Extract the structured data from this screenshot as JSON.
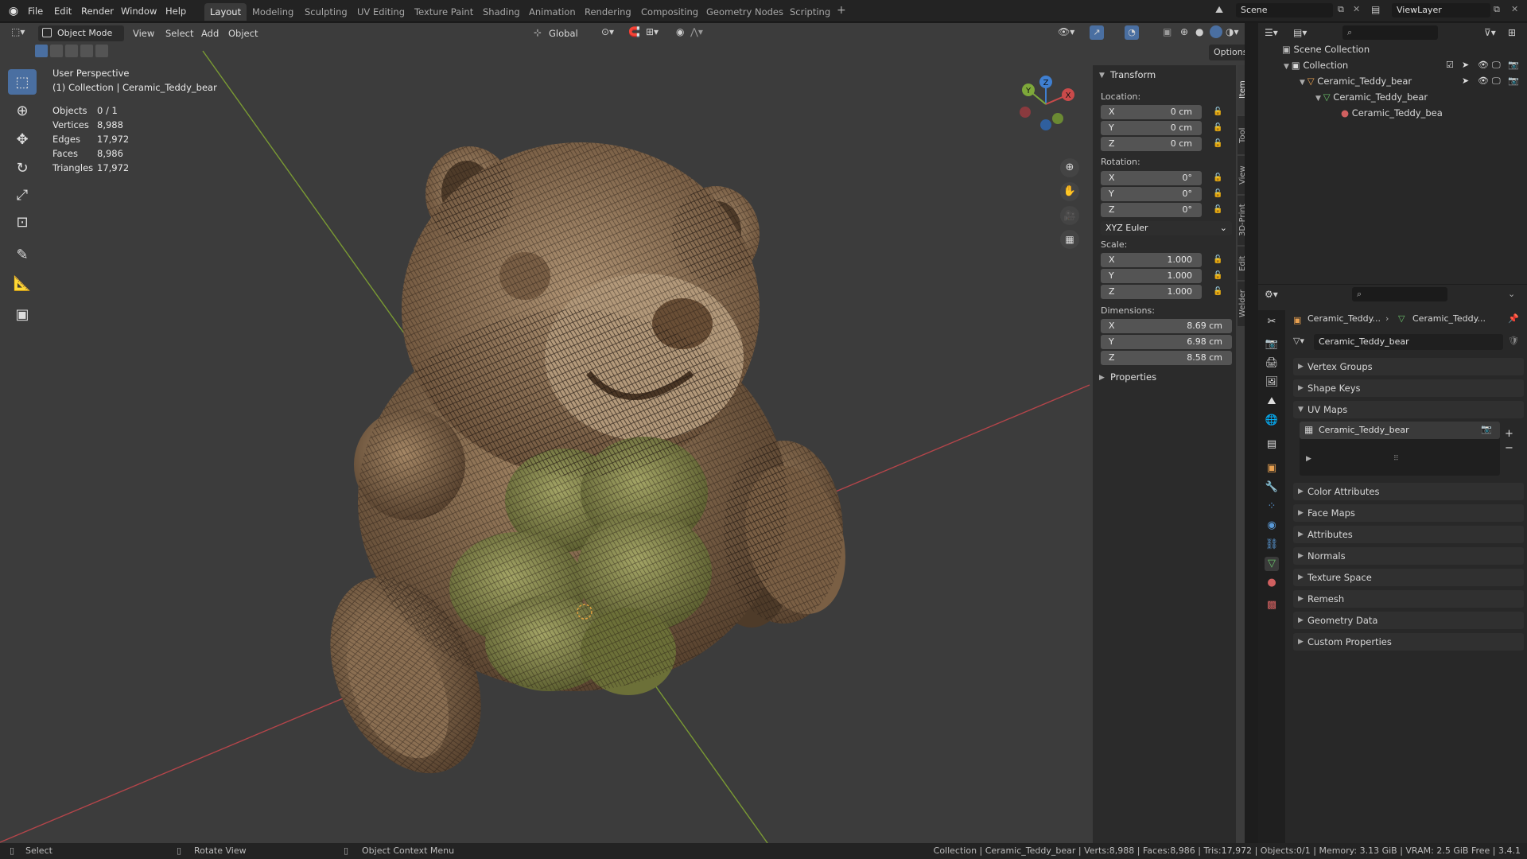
{
  "menu": [
    "File",
    "Edit",
    "Render",
    "Window",
    "Help"
  ],
  "workspaces": [
    "Layout",
    "Modeling",
    "Sculpting",
    "UV Editing",
    "Texture Paint",
    "Shading",
    "Animation",
    "Rendering",
    "Compositing",
    "Geometry Nodes",
    "Scripting"
  ],
  "active_workspace": "Layout",
  "scene": "Scene",
  "view_layer": "ViewLayer",
  "viewport": {
    "mode": "Object Mode",
    "menus": [
      "View",
      "Select",
      "Add",
      "Object"
    ],
    "orientation": "Global",
    "options": "Options",
    "overlay_title": "User Perspective",
    "overlay_subtitle": "(1) Collection | Ceramic_Teddy_bear",
    "stats": [
      {
        "label": "Objects",
        "value": "0 / 1"
      },
      {
        "label": "Vertices",
        "value": "8,988"
      },
      {
        "label": "Edges",
        "value": "17,972"
      },
      {
        "label": "Faces",
        "value": "8,986"
      },
      {
        "label": "Triangles",
        "value": "17,972"
      }
    ],
    "gizmo_axes": {
      "x": "X",
      "y": "Y",
      "z": "Z"
    }
  },
  "npanel": {
    "transform": "Transform",
    "location_label": "Location:",
    "location": [
      {
        "axis": "X",
        "value": "0 cm"
      },
      {
        "axis": "Y",
        "value": "0 cm"
      },
      {
        "axis": "Z",
        "value": "0 cm"
      }
    ],
    "rotation_label": "Rotation:",
    "rotation": [
      {
        "axis": "X",
        "value": "0°"
      },
      {
        "axis": "Y",
        "value": "0°"
      },
      {
        "axis": "Z",
        "value": "0°"
      }
    ],
    "rotation_mode": "XYZ Euler",
    "scale_label": "Scale:",
    "scale": [
      {
        "axis": "X",
        "value": "1.000"
      },
      {
        "axis": "Y",
        "value": "1.000"
      },
      {
        "axis": "Z",
        "value": "1.000"
      }
    ],
    "dimensions_label": "Dimensions:",
    "dimensions": [
      {
        "axis": "X",
        "value": "8.69 cm"
      },
      {
        "axis": "Y",
        "value": "6.98 cm"
      },
      {
        "axis": "Z",
        "value": "8.58 cm"
      }
    ],
    "properties": "Properties",
    "tabs": [
      "Item",
      "Tool",
      "View",
      "3D-Print",
      "Edit",
      "Welder"
    ]
  },
  "outliner": {
    "root": "Scene Collection",
    "collection": "Collection",
    "object": "Ceramic_Teddy_bear",
    "mesh": "Ceramic_Teddy_bear",
    "material": "Ceramic_Teddy_bea"
  },
  "properties": {
    "breadcrumb_obj": "Ceramic_Teddy...",
    "breadcrumb_data": "Ceramic_Teddy...",
    "datablock": "Ceramic_Teddy_bear",
    "panels_top": [
      "Vertex Groups",
      "Shape Keys"
    ],
    "uv_maps_label": "UV Maps",
    "uv_map_item": "Ceramic_Teddy_bear",
    "panels_bottom": [
      "Color Attributes",
      "Face Maps",
      "Attributes",
      "Normals",
      "Texture Space",
      "Remesh",
      "Geometry Data",
      "Custom Properties"
    ]
  },
  "statusbar": {
    "select": "Select",
    "rotate": "Rotate View",
    "context": "Object Context Menu",
    "info": "Collection | Ceramic_Teddy_bear | Verts:8,988 | Faces:8,986 | Tris:17,972 | Objects:0/1 | Memory: 3.13 GiB | VRAM: 2.5 GiB Free | 3.4.1"
  },
  "colors": {
    "accent": "#4a6fa1",
    "x_axis": "#c94a4a",
    "y_axis": "#7ea83a",
    "z_axis": "#3f7fd1",
    "bear": "#8a6a4a",
    "clover": "#8a8f4a"
  }
}
